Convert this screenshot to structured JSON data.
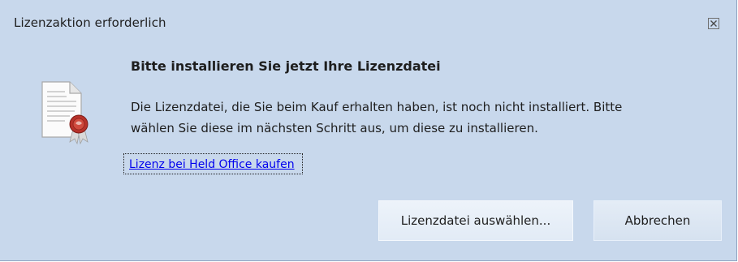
{
  "window": {
    "title": "Lizenzaktion erforderlich"
  },
  "icons": {
    "close": "close-icon",
    "document": "license-certificate-icon"
  },
  "content": {
    "heading": "Bitte installieren Sie jetzt Ihre Lizenzdatei",
    "message_line1": "Die Lizenzdatei, die Sie beim Kauf erhalten haben, ist noch nicht installiert. Bitte",
    "message_line2": "wählen Sie diese im nächsten Schritt aus, um diese zu installieren.",
    "link_label": "Lizenz bei Held Office kaufen"
  },
  "buttons": {
    "select_label": "Lizenzdatei auswählen...",
    "cancel_label": "Abbrechen"
  },
  "colors": {
    "background": "#c8d8ec",
    "link": "#0000ee",
    "seal": "#b8322a"
  }
}
